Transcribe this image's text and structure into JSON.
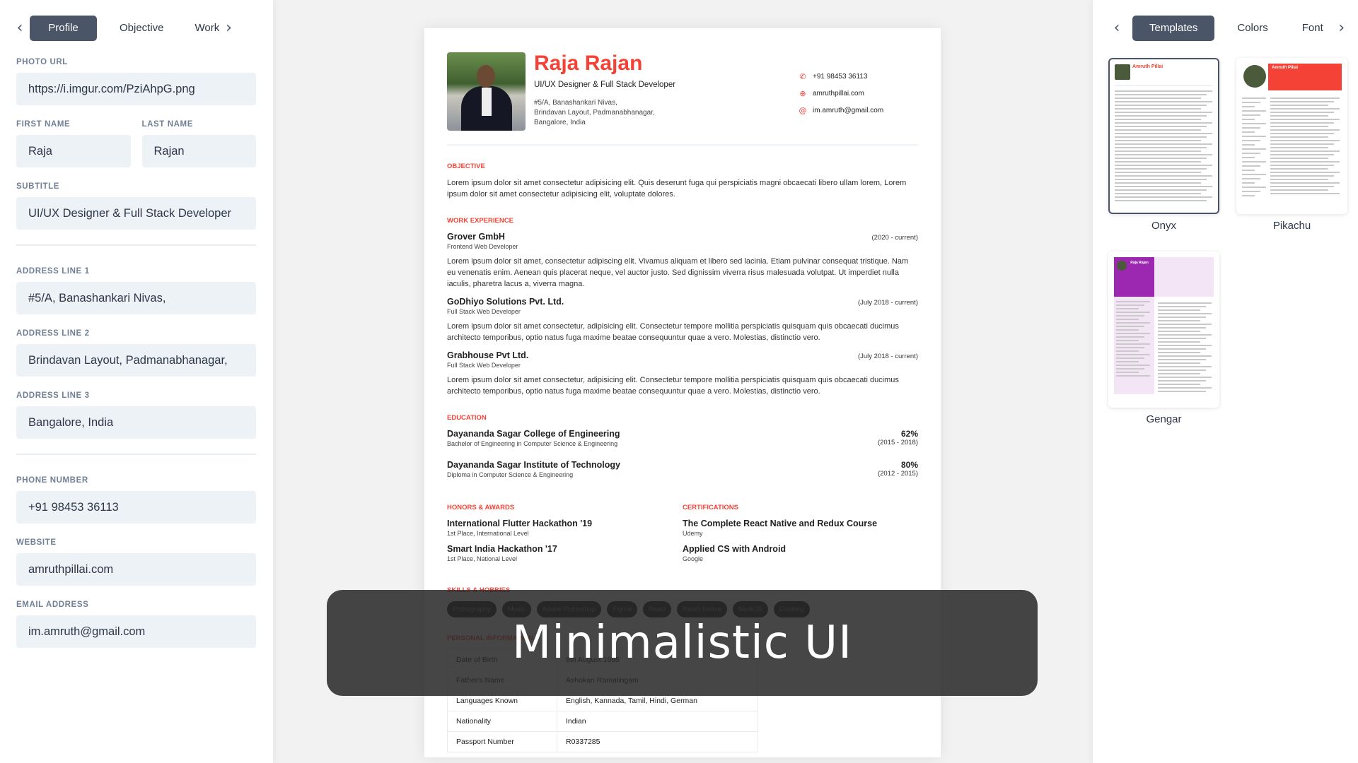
{
  "left_panel": {
    "tabs": [
      {
        "label": "Profile",
        "active": true
      },
      {
        "label": "Objective",
        "active": false
      },
      {
        "label": "Work Experience",
        "active": false
      }
    ],
    "fields": {
      "photo_url": {
        "label": "Photo URL",
        "value": "https://i.imgur.com/PziAhpG.png"
      },
      "first_name": {
        "label": "First Name",
        "value": "Raja"
      },
      "last_name": {
        "label": "Last Name",
        "value": "Rajan"
      },
      "subtitle": {
        "label": "Subtitle",
        "value": "UI/UX Designer & Full Stack Developer"
      },
      "address_line_1": {
        "label": "Address Line 1",
        "value": "#5/A, Banashankari Nivas,"
      },
      "address_line_2": {
        "label": "Address Line 2",
        "value": "Brindavan Layout, Padmanabhanagar,"
      },
      "address_line_3": {
        "label": "Address Line 3",
        "value": "Bangalore, India"
      },
      "phone": {
        "label": "Phone Number",
        "value": "+91 98453 36113"
      },
      "website": {
        "label": "Website",
        "value": "amruthpillai.com"
      },
      "email": {
        "label": "Email Address",
        "value": "im.amruth@gmail.com"
      }
    }
  },
  "resume": {
    "accent_color": "#f44336",
    "name": "Raja Rajan",
    "subtitle": "UI/UX Designer & Full Stack Developer",
    "address": [
      "#5/A, Banashankari Nivas,",
      "Brindavan Layout, Padmanabhanagar,",
      "Bangalore, India"
    ],
    "contacts": {
      "phone": {
        "icon": "phone-icon",
        "value": "+91 98453 36113"
      },
      "website": {
        "icon": "globe-icon",
        "value": "amruthpillai.com"
      },
      "email": {
        "icon": "at-icon",
        "value": "im.amruth@gmail.com"
      }
    },
    "sections": {
      "objective": "Objective",
      "work": "Work Experience",
      "education": "Education",
      "honors": "Honors & Awards",
      "certifications": "Certifications",
      "skills": "Skills & Hobbies",
      "personal": "Personal Information"
    },
    "objective": "Lorem ipsum dolor sit amet consectetur adipisicing elit. Quis deserunt fuga qui perspiciatis magni obcaecati libero ullam lorem, Lorem ipsum dolor sit amet consectetur adipisicing elit, voluptate dolores.",
    "work": [
      {
        "company": "Grover GmbH",
        "role": "Frontend Web Developer",
        "period": "(2020 - current)",
        "description": "Lorem ipsum dolor sit amet, consectetur adipiscing elit. Vivamus aliquam et libero sed lacinia. Etiam pulvinar consequat tristique. Nam eu venenatis enim. Aenean quis placerat neque, vel auctor justo. Sed dignissim viverra risus malesuada volutpat. Ut imperdiet nulla iaculis, pharetra lacus a, viverra magna."
      },
      {
        "company": "GoDhiyo Solutions Pvt. Ltd.",
        "role": "Full Stack Web Developer",
        "period": "(July 2018 - current)",
        "description": "Lorem ipsum dolor sit amet consectetur, adipisicing elit. Consectetur tempore mollitia perspiciatis quisquam quis obcaecati ducimus architecto temporibus, optio natus fuga maxime beatae consequuntur quae a vero. Molestias, distinctio vero."
      },
      {
        "company": "Grabhouse Pvt Ltd.",
        "role": "Full Stack Web Developer",
        "period": "(July 2018 - current)",
        "description": "Lorem ipsum dolor sit amet consectetur, adipisicing elit. Consectetur tempore mollitia perspiciatis quisquam quis obcaecati ducimus architecto temporibus, optio natus fuga maxime beatae consequuntur quae a vero. Molestias, distinctio vero."
      }
    ],
    "education": [
      {
        "school": "Dayananda Sagar College of Engineering",
        "degree": "Bachelor of Engineering in Computer Science & Engineering",
        "grade": "62%",
        "period": "(2015 - 2018)"
      },
      {
        "school": "Dayananda Sagar Institute of Technology",
        "degree": "Diploma in Computer Science & Engineering",
        "grade": "80%",
        "period": "(2012 - 2015)"
      }
    ],
    "honors": [
      {
        "title": "International Flutter Hackathon '19",
        "detail": "1st Place, International Level"
      },
      {
        "title": "Smart India Hackathon '17",
        "detail": "1st Place, National Level"
      }
    ],
    "certifications": [
      {
        "title": "The Complete React Native and Redux Course",
        "detail": "Udemy"
      },
      {
        "title": "Applied CS with Android",
        "detail": "Google"
      }
    ],
    "skills": [
      "Photography",
      "Music",
      "Adobe Photoshop",
      "Figma",
      "React",
      "React Native",
      "NodeJS",
      "Cooking"
    ],
    "personal": [
      {
        "key": "Date of Birth",
        "value": "6th August 1995"
      },
      {
        "key": "Father's Name",
        "value": "Ashokan Ramalingam"
      },
      {
        "key": "Languages Known",
        "value": "English, Kannada, Tamil, Hindi, German"
      },
      {
        "key": "Nationality",
        "value": "Indian"
      },
      {
        "key": "Passport Number",
        "value": "R0337285"
      }
    ]
  },
  "overlay": {
    "text": "Minimalistic UI"
  },
  "right_panel": {
    "tabs": [
      {
        "label": "Templates",
        "active": true
      },
      {
        "label": "Colors",
        "active": false
      },
      {
        "label": "Fonts",
        "active": false
      }
    ],
    "templates": [
      {
        "name": "Onyx",
        "selected": true,
        "preview_name": "Amruth Pillai"
      },
      {
        "name": "Pikachu",
        "selected": false,
        "preview_name": "Amruth Pillai"
      },
      {
        "name": "Gengar",
        "selected": false,
        "preview_name": "Raja Rajan"
      }
    ]
  }
}
